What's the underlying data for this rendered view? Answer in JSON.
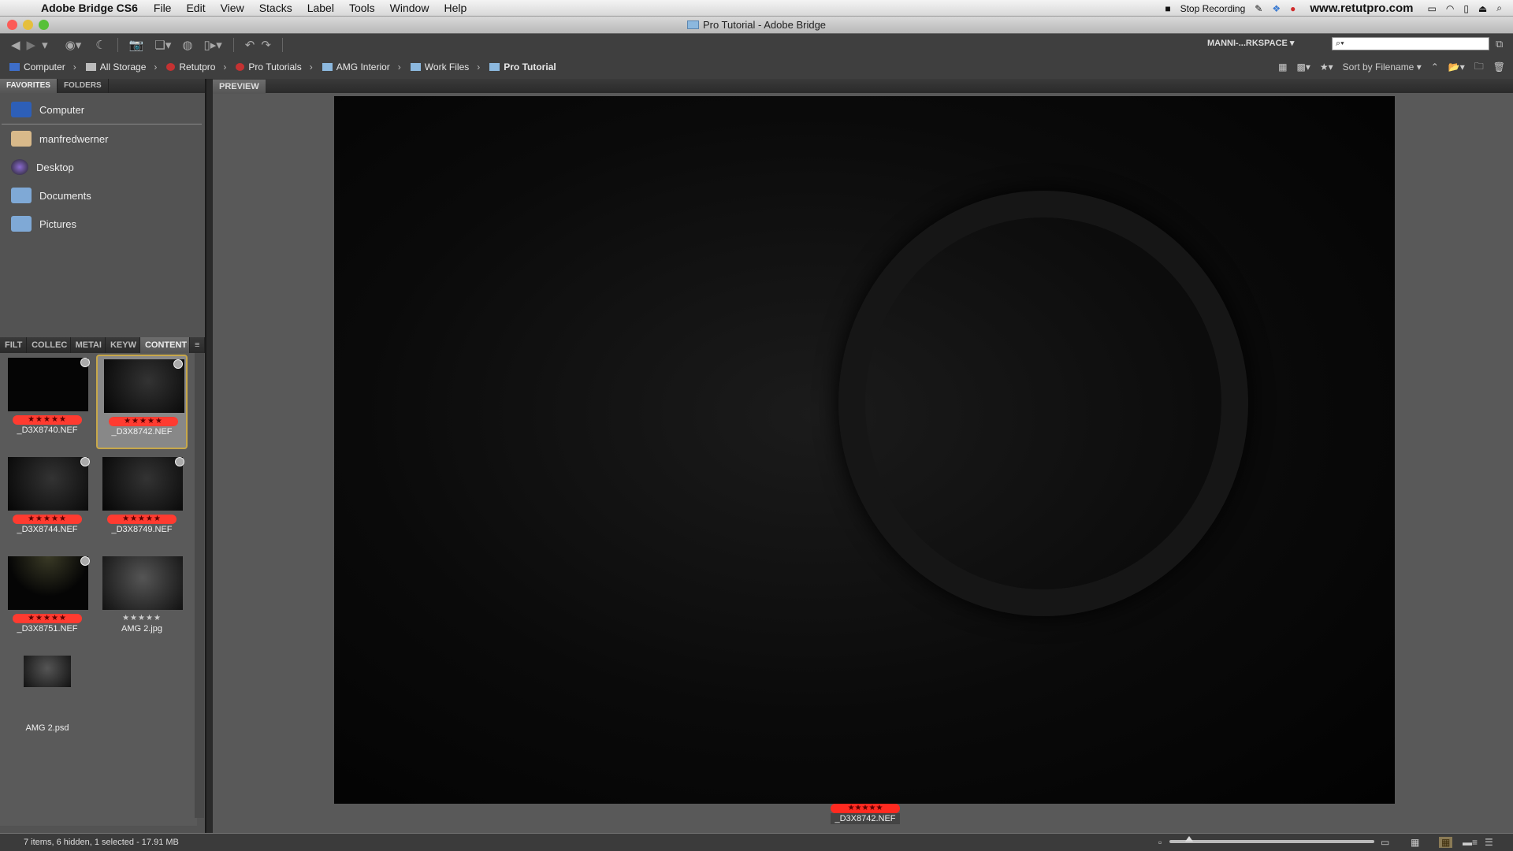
{
  "menubar": {
    "app_name": "Adobe Bridge CS6",
    "items": [
      "File",
      "Edit",
      "View",
      "Stacks",
      "Label",
      "Tools",
      "Window",
      "Help"
    ],
    "recording": "Stop Recording",
    "url": "www.retutpro.com"
  },
  "window": {
    "title": "Pro Tutorial - Adobe Bridge",
    "traffic_colors": [
      "#fc5b57",
      "#e5bf3c",
      "#57c038"
    ]
  },
  "toolbar": {
    "workspace": "MANNI-...RKSPACE",
    "search_placeholder": "",
    "search_icon": "search-icon"
  },
  "path": {
    "crumbs": [
      "Computer",
      "All Storage",
      "Retutpro",
      "Pro Tutorials",
      "AMG Interior",
      "Work Files",
      "Pro Tutorial"
    ],
    "sort": "Sort by Filename"
  },
  "left_panel": {
    "tabs": [
      "FAVORITES",
      "FOLDERS"
    ],
    "favorites": [
      {
        "label": "Computer",
        "icon": "computer-icon",
        "color": "#2d5fb8"
      },
      {
        "label": "manfredwerner",
        "icon": "home-icon",
        "color": "#d8b98a"
      },
      {
        "label": "Desktop",
        "icon": "desktop-icon",
        "color": "#6a4c9c"
      },
      {
        "label": "Documents",
        "icon": "documents-folder-icon",
        "color": "#7fa9d6"
      },
      {
        "label": "Pictures",
        "icon": "pictures-folder-icon",
        "color": "#7fa9d6"
      }
    ],
    "content_tabs": [
      "FILT",
      "COLLEC",
      "METAI",
      "KEYW",
      "CONTENT"
    ]
  },
  "content": {
    "items": [
      {
        "name": "_D3X8740.NEF",
        "rating": 5,
        "label": "red",
        "selected": false
      },
      {
        "name": "_D3X8742.NEF",
        "rating": 5,
        "label": "red",
        "selected": true
      },
      {
        "name": "_D3X8744.NEF",
        "rating": 5,
        "label": "red",
        "selected": false
      },
      {
        "name": "_D3X8749.NEF",
        "rating": 5,
        "label": "red",
        "selected": false
      },
      {
        "name": "_D3X8751.NEF",
        "rating": 5,
        "label": "red",
        "selected": false
      },
      {
        "name": "AMG 2.jpg",
        "rating": 0,
        "label": "none",
        "selected": false
      },
      {
        "name": "AMG 2.psd",
        "rating": null,
        "label": "none",
        "selected": false
      }
    ]
  },
  "preview": {
    "tab": "PREVIEW",
    "caption_name": "_D3X8742.NEF",
    "caption_rating": 5,
    "stars": "★★★★★"
  },
  "status": {
    "text": "7 items, 6 hidden, 1 selected - 17.91 MB",
    "thumbnail_size": 0.1
  }
}
